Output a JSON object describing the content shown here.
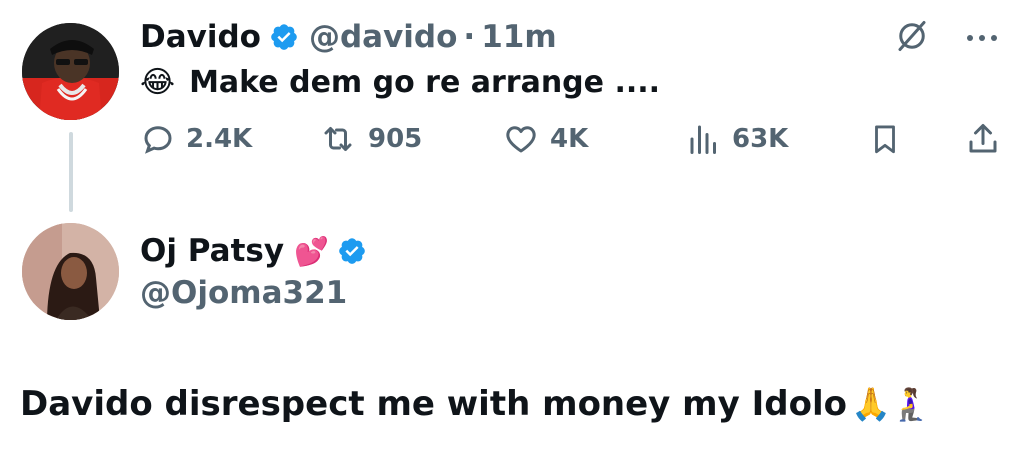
{
  "tweet": {
    "author_name": "Davido",
    "author_handle": "@davido",
    "separator": "·",
    "time": "11m",
    "text": "Make dem go re arrange ....",
    "emoji": "😂",
    "icons": {
      "verified": "verified-badge-icon",
      "grok": "grok-icon",
      "more": "more-options-icon"
    },
    "actions": {
      "replies": "2.4K",
      "reposts": "905",
      "likes": "4K",
      "views": "63K"
    },
    "accent_color": "#1d9bf0"
  },
  "reply": {
    "author_name": "Oj Patsy",
    "author_emoji": "💕",
    "author_handle": "@Ojoma321",
    "text": "Davido disrespect me with money my Idolo",
    "trailing_emojis": "🙏🧎‍♀️"
  }
}
